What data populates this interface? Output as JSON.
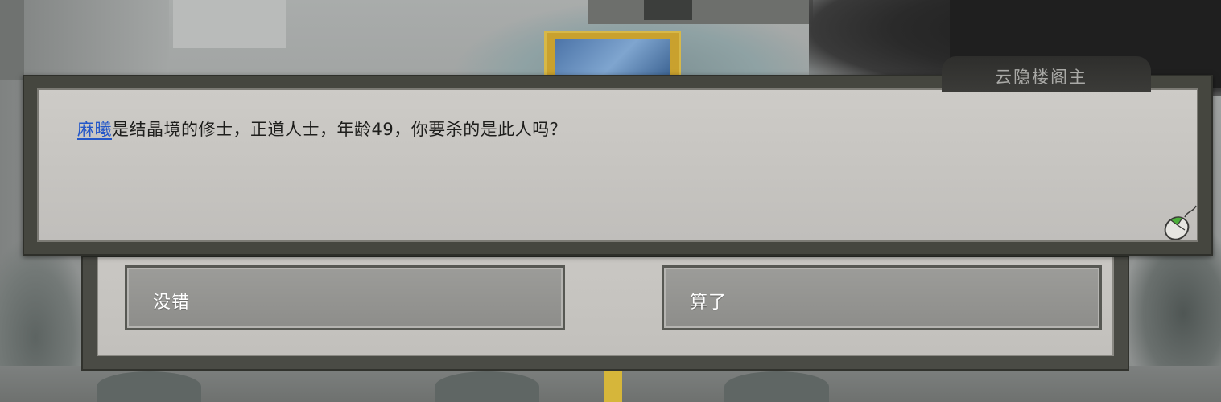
{
  "speaker": {
    "name": "云隐楼阁主"
  },
  "dialog": {
    "name_highlight": "麻曦",
    "text": "是结晶境的修士，正道人士，年龄49，你要杀的是此人吗？",
    "continue_icon": "mouse-icon"
  },
  "choices": [
    {
      "label": "没错"
    },
    {
      "label": "算了"
    }
  ],
  "colors": {
    "name_highlight": "#2457c8",
    "dialog_text": "#1e1e1c",
    "speaker_name": "#a9a9a6",
    "choice_text": "#ffffff",
    "frame": "#45463f",
    "paper": "#c8c6c2",
    "mouse_button_accent": "#4caf3b"
  }
}
